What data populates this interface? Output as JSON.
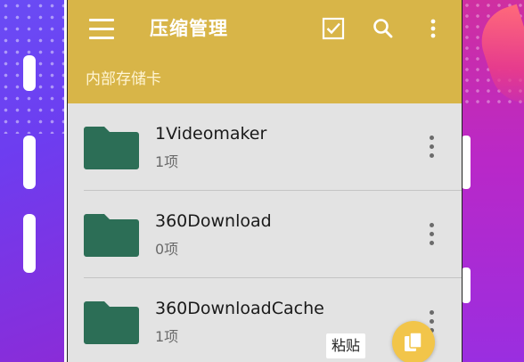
{
  "appbar": {
    "title": "压缩管理",
    "path": "内部存储卡",
    "icons": [
      "menu-icon",
      "checkbox-icon",
      "search-icon",
      "more-vert-icon"
    ]
  },
  "folders": [
    {
      "name": "1Videomaker",
      "count": "1项"
    },
    {
      "name": "360Download",
      "count": "0项"
    },
    {
      "name": "360DownloadCache",
      "count": "1项"
    }
  ],
  "paste": {
    "label": "粘贴"
  },
  "colors": {
    "appbar": "#d8b548",
    "folder": "#2c6e56",
    "fab": "#f2c54a",
    "list_bg": "#e3e3e3"
  }
}
